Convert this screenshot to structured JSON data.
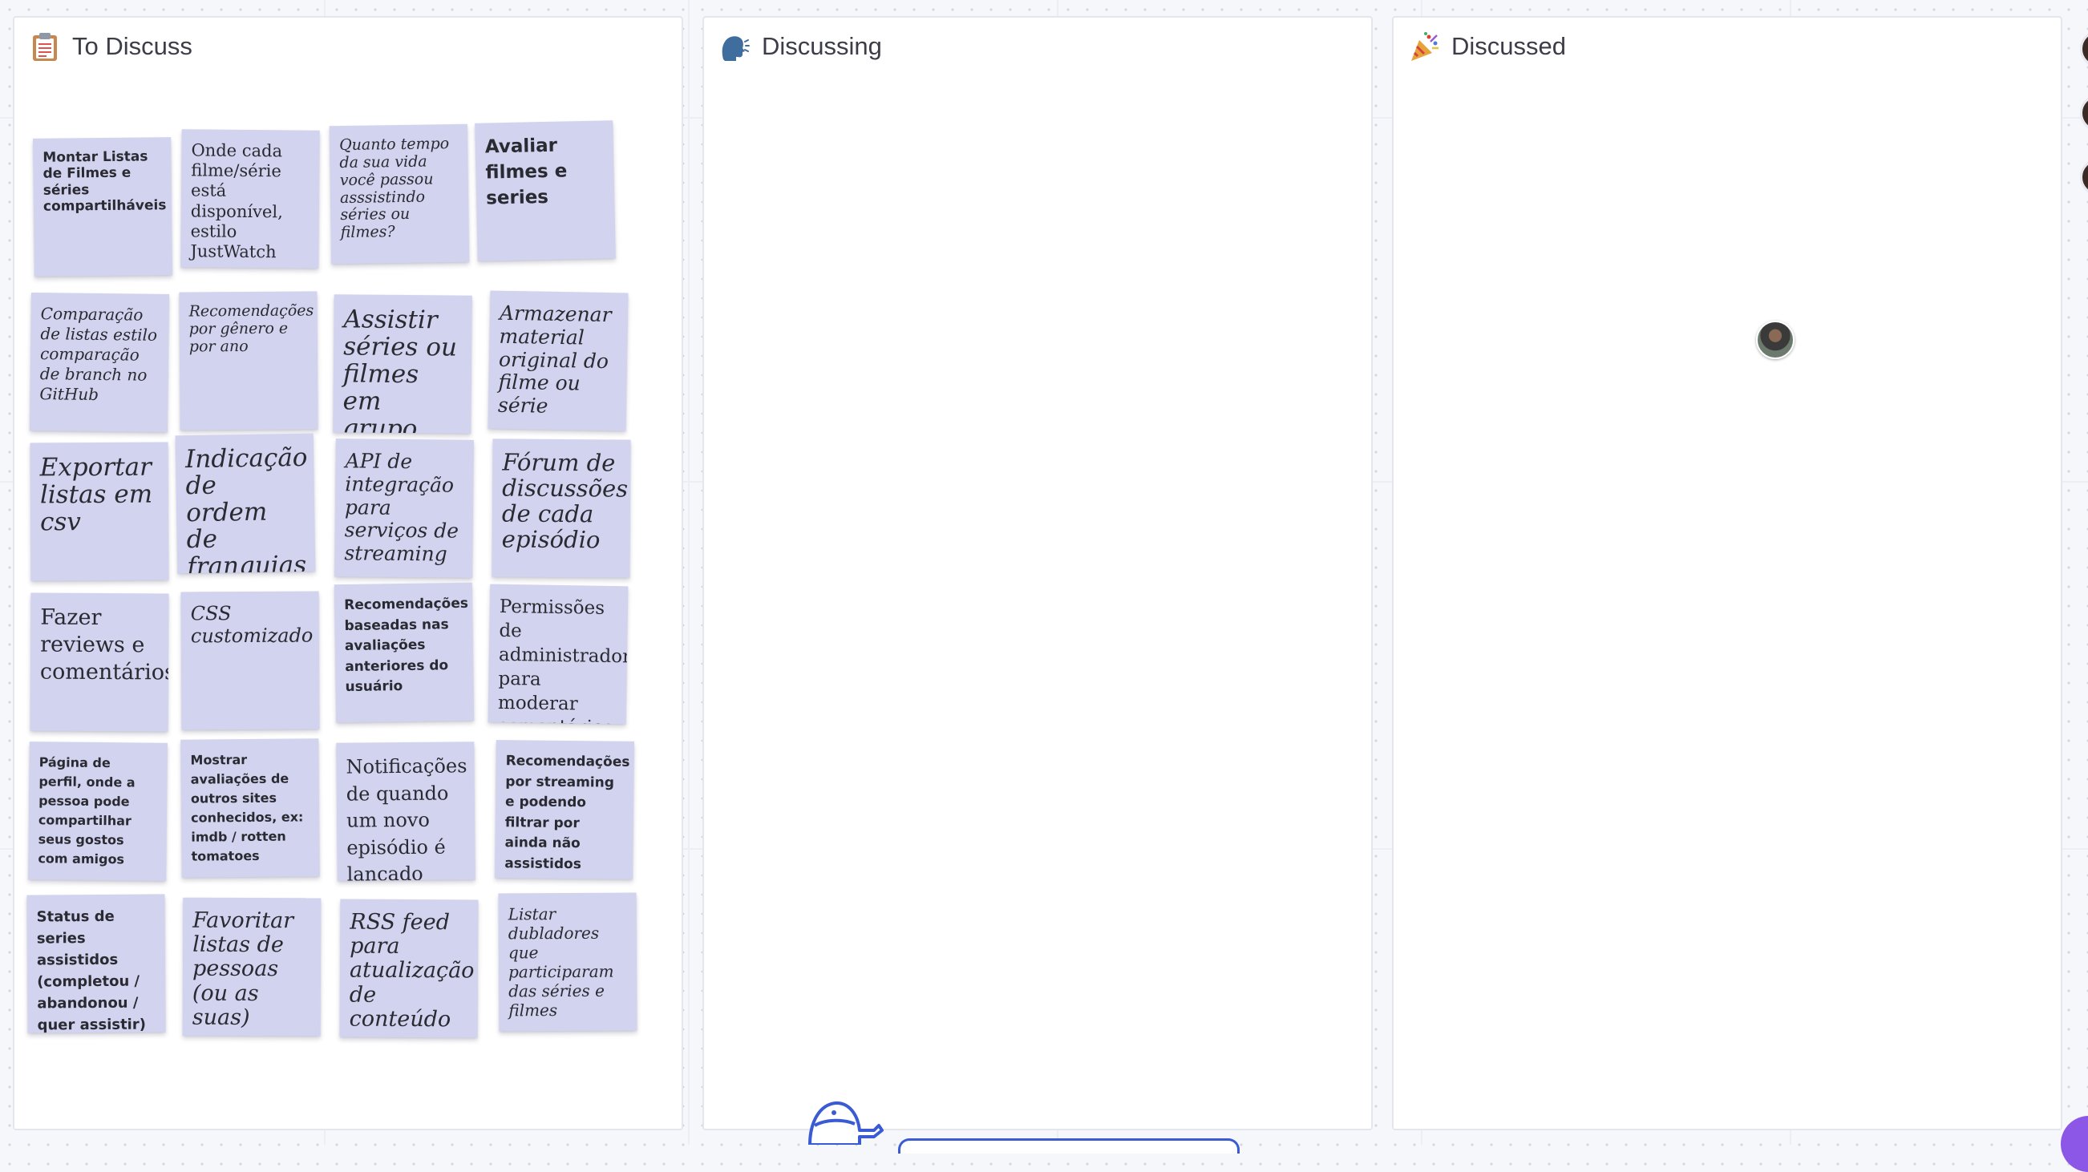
{
  "board": {
    "columns": [
      {
        "title": "To Discuss",
        "icon": "clipboard-icon"
      },
      {
        "title": "Discussing",
        "icon": "speaking-head-icon"
      },
      {
        "title": "Discussed",
        "icon": "party-popper-icon"
      }
    ]
  },
  "stickies": [
    "Montar Listas de Filmes e séries compartilháveis",
    "Onde cada filme/série está disponível, estilo JustWatch",
    "Quanto tempo da sua vida você passou asssistindo séries ou filmes?",
    "Avaliar filmes e series",
    "Comparação de listas estilo comparação de branch no GitHub",
    "Recomendações por gênero e por ano",
    "Assistir séries ou filmes em grupo",
    "Armazenar material original do filme ou série",
    "Exportar listas em csv",
    "Indicação de ordem de franquias",
    "API de integração para serviços de streaming",
    "Fórum de discussões de cada episódio",
    "Fazer reviews e comentários",
    "CSS customizado",
    "Recomendações baseadas nas avaliações anteriores do usuário",
    "Permissões de administrador para moderar comentários",
    "Página de perfil, onde a pessoa pode compartilhar seus gostos com amigos",
    "Mostrar avaliações de outros sites conhecidos, ex: imdb / rotten tomatoes",
    "Notificações de quando um novo episódio é lançado",
    "Recomendações por streaming e podendo filtrar por ainda não assistidos",
    "Status de series assistidos (completou / abandonou / quer assistir)",
    "Favoritar listas de pessoas (ou as suas)",
    "RSS feed para atualização de conteúdo",
    "Listar dubladores que participaram das séries e filmes"
  ],
  "colors": {
    "sticky": "#d2d3ee",
    "accent": "#3a5bd4",
    "purple": "#8c56e6"
  }
}
